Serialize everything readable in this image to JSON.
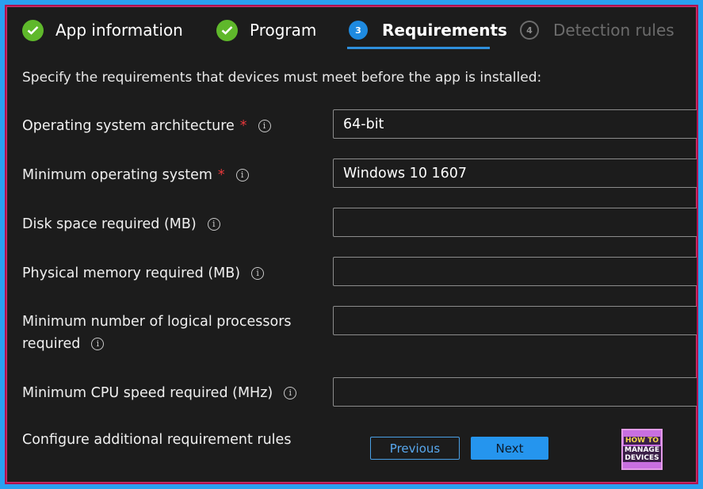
{
  "wizard": {
    "steps": [
      {
        "label": "App information",
        "state": "complete"
      },
      {
        "label": "Program",
        "state": "complete"
      },
      {
        "label": "Requirements",
        "state": "current",
        "number": "3"
      },
      {
        "label": "Detection rules",
        "state": "upcoming",
        "number": "4"
      }
    ]
  },
  "intro": "Specify the requirements that devices must meet before the app is installed:",
  "fields": [
    {
      "label": "Operating system architecture",
      "required": true,
      "value": "64-bit"
    },
    {
      "label": "Minimum operating system",
      "required": true,
      "value": "Windows 10 1607"
    },
    {
      "label": "Disk space required (MB)",
      "required": false,
      "value": ""
    },
    {
      "label": "Physical memory required (MB)",
      "required": false,
      "value": ""
    },
    {
      "label_line1": "Minimum number of logical processors",
      "label_line2": "required",
      "required": false,
      "value": ""
    },
    {
      "label": "Minimum CPU speed required (MHz)",
      "required": false,
      "value": ""
    }
  ],
  "required_marker": "*",
  "info_glyph": "i",
  "additional_rules_label": "Configure additional requirement rules",
  "buttons": {
    "previous": "Previous",
    "next": "Next"
  },
  "logo": {
    "line1": "HOW TO",
    "line2": "MANAGE",
    "line3": "DEVICES"
  },
  "colors": {
    "accent": "#2595ee",
    "check": "#5fb82b",
    "required": "#e8383b",
    "border": "#b1124f"
  }
}
